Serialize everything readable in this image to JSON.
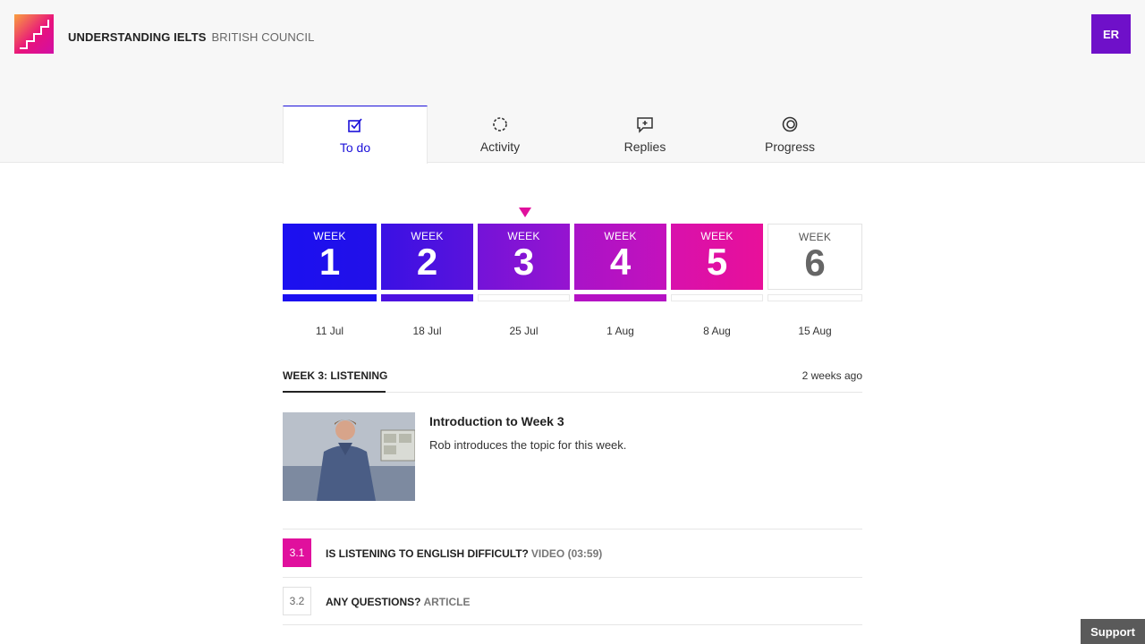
{
  "header": {
    "course_title": "UNDERSTANDING IELTS",
    "organisation": "BRITISH COUNCIL",
    "avatar_initials": "ER",
    "logo_icon": "stairs-icon"
  },
  "tabs": [
    {
      "label": "To do",
      "icon": "checkbox-edit-icon",
      "active": true
    },
    {
      "label": "Activity",
      "icon": "activity-circle-icon",
      "active": false
    },
    {
      "label": "Replies",
      "icon": "comment-add-icon",
      "active": false
    },
    {
      "label": "Progress",
      "icon": "progress-donut-icon",
      "active": false
    }
  ],
  "weeks": [
    {
      "label": "WEEK",
      "number": "1",
      "date": "11 Jul",
      "color": "#1b10f0",
      "bar": true
    },
    {
      "label": "WEEK",
      "number": "2",
      "date": "18 Jul",
      "color": "#4d12e0",
      "bar": true
    },
    {
      "label": "WEEK",
      "number": "3",
      "date": "25 Jul",
      "color": "#8a14d4",
      "bar": false,
      "current": true
    },
    {
      "label": "WEEK",
      "number": "4",
      "date": "1 Aug",
      "color": "#b512c4",
      "bar": true
    },
    {
      "label": "WEEK",
      "number": "5",
      "date": "8 Aug",
      "color": "#e0109d",
      "bar": false
    },
    {
      "label": "WEEK",
      "number": "6",
      "date": "15 Aug",
      "color": "#ffffff",
      "bar": false
    }
  ],
  "section": {
    "title": "WEEK 3: LISTENING",
    "time": "2 weeks ago"
  },
  "intro": {
    "title": "Introduction to Week 3",
    "description": "Rob introduces the topic for this week."
  },
  "steps": [
    {
      "number": "3.1",
      "title": "IS LISTENING TO ENGLISH DIFFICULT?",
      "type": "VIDEO (03:59)",
      "completed": true
    },
    {
      "number": "3.2",
      "title": "ANY QUESTIONS?",
      "type": "ARTICLE",
      "completed": false
    }
  ],
  "support_label": "Support"
}
